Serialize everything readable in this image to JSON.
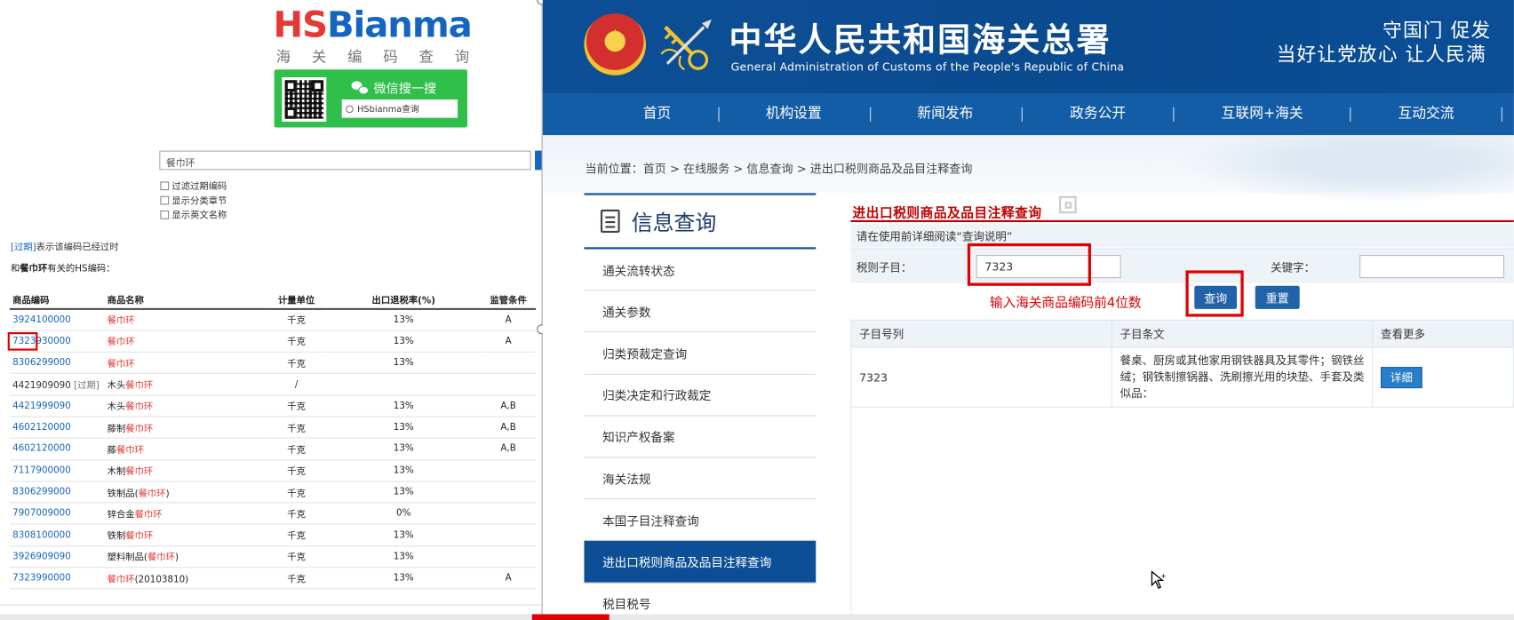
{
  "left": {
    "logo": {
      "part1": "HS",
      "part2": "Bianma"
    },
    "logo_sub": [
      "海",
      "关",
      "编",
      "码",
      "查",
      "询"
    ],
    "wechat": {
      "title": "微信搜一搜",
      "search_text": "HSbianma查询"
    },
    "search": {
      "value": "餐巾环"
    },
    "checkboxes": [
      "过滤过期编码",
      "显示分类章节",
      "显示英文名称"
    ],
    "note": {
      "tag": "[过期]",
      "text": "表示该编码已经过时"
    },
    "related": {
      "keyword": "餐巾环",
      "text": "有关的HS编码："
    },
    "table": {
      "headers": [
        "商品编码",
        "商品名称",
        "计量单位",
        "出口退税率(%)",
        "监管条件"
      ],
      "rows": [
        {
          "code": "3924100000",
          "expired": "",
          "name_pre": "",
          "name_kw": "餐巾环",
          "name_post": "",
          "unit": "千克",
          "rate": "13%",
          "cond": "A"
        },
        {
          "code": "7323930000",
          "expired": "",
          "name_pre": "",
          "name_kw": "餐巾环",
          "name_post": "",
          "unit": "千克",
          "rate": "13%",
          "cond": "A"
        },
        {
          "code": "8306299000",
          "expired": "",
          "name_pre": "",
          "name_kw": "餐巾环",
          "name_post": "",
          "unit": "千克",
          "rate": "13%",
          "cond": ""
        },
        {
          "code": "4421909090",
          "expired": "[过期]",
          "name_pre": "木头",
          "name_kw": "餐巾环",
          "name_post": "",
          "unit": "/",
          "rate": "",
          "cond": ""
        },
        {
          "code": "4421999090",
          "expired": "",
          "name_pre": "木头",
          "name_kw": "餐巾环",
          "name_post": "",
          "unit": "千克",
          "rate": "13%",
          "cond": "A,B"
        },
        {
          "code": "4602120000",
          "expired": "",
          "name_pre": "藤制",
          "name_kw": "餐巾环",
          "name_post": "",
          "unit": "千克",
          "rate": "13%",
          "cond": "A,B"
        },
        {
          "code": "4602120000",
          "expired": "",
          "name_pre": "藤",
          "name_kw": "餐巾环",
          "name_post": "",
          "unit": "千克",
          "rate": "13%",
          "cond": "A,B"
        },
        {
          "code": "7117900000",
          "expired": "",
          "name_pre": "木制",
          "name_kw": "餐巾环",
          "name_post": "",
          "unit": "千克",
          "rate": "13%",
          "cond": ""
        },
        {
          "code": "8306299000",
          "expired": "",
          "name_pre": "铁制品(",
          "name_kw": "餐巾环",
          "name_post": ")",
          "unit": "千克",
          "rate": "13%",
          "cond": ""
        },
        {
          "code": "7907009000",
          "expired": "",
          "name_pre": "锌合金",
          "name_kw": "餐巾环",
          "name_post": "",
          "unit": "千克",
          "rate": "0%",
          "cond": ""
        },
        {
          "code": "8308100000",
          "expired": "",
          "name_pre": "铁制",
          "name_kw": "餐巾环",
          "name_post": "",
          "unit": "千克",
          "rate": "13%",
          "cond": ""
        },
        {
          "code": "3926909090",
          "expired": "",
          "name_pre": "塑料制品(",
          "name_kw": "餐巾环",
          "name_post": ")",
          "unit": "千克",
          "rate": "13%",
          "cond": ""
        },
        {
          "code": "7323990000",
          "expired": "",
          "name_pre": "",
          "name_kw": "餐巾环",
          "name_post": "(20103810)",
          "unit": "千克",
          "rate": "13%",
          "cond": "A"
        }
      ]
    }
  },
  "right": {
    "org_cn": "中华人民共和国海关总署",
    "org_en": "General Administration of Customs of the People's Republic of China",
    "slogan_line1": "守国门    促发",
    "slogan_line2": "当好让党放心    让人民满",
    "nav": [
      "首页",
      "机构设置",
      "新闻发布",
      "政务公开",
      "互联网+海关",
      "互动交流"
    ],
    "breadcrumb": "当前位置：首页 > 在线服务 > 信息查询 > 进出口税则商品及品目注释查询",
    "sidebar": {
      "title": "信息查询",
      "items": [
        "通关流转状态",
        "通关参数",
        "归类预裁定查询",
        "归类决定和行政裁定",
        "知识产权备案",
        "海关法规",
        "本国子目注释查询",
        "进出口税则商品及品目注释查询",
        "税目税号"
      ]
    },
    "content_title": "进出口税则商品及品目注释查询",
    "info": "请在使用前详细阅读“查询说明”",
    "form": {
      "tariff_label": "税则子目：",
      "tariff_value": "7323",
      "keyword_label": "关键字：",
      "keyword_value": "",
      "hint": "输入海关商品编码前4位数",
      "query_button": "查询",
      "reset_button": "重置"
    },
    "results": {
      "headers": [
        "子目号列",
        "子目条文",
        "查看更多"
      ],
      "rows": [
        {
          "code": "7323",
          "desc": "餐桌、厨房或其他家用钢铁器具及其零件；钢铁丝绒；钢铁制擦锅器、洗刷擦光用的块垫、手套及类似品：",
          "button": "详细"
        }
      ]
    }
  },
  "colors": {
    "brand_blue": "#0d4f96",
    "alert_red": "#e00000",
    "link_blue": "#1565c0",
    "keyword_red": "#e53935"
  }
}
